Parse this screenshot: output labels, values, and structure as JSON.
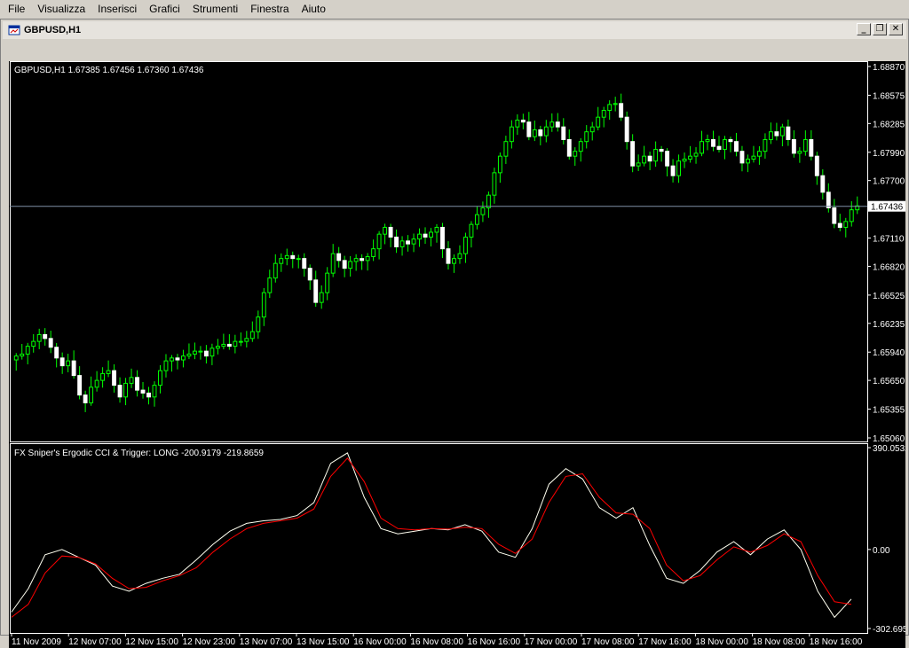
{
  "menu": {
    "items": [
      "File",
      "Visualizza",
      "Inserisci",
      "Grafici",
      "Strumenti",
      "Finestra",
      "Aiuto"
    ]
  },
  "window": {
    "title": "GBPUSD,H1",
    "buttons": {
      "minimize": "_",
      "restore": "❐",
      "close": "✕"
    }
  },
  "colors": {
    "background": "#000000",
    "bull": "#ffffff",
    "bear": "#ffffff",
    "wick": "#00ff00",
    "grid_frame": "#ffffff",
    "cci_line": "#fffff0",
    "trigger_line": "#ff0000",
    "price_line": "#7f8fa6"
  },
  "chart_data": [
    {
      "type": "candlestick",
      "symbol_info": "GBPUSD,H1  1.67385 1.67456 1.67360 1.67436",
      "current_price": 1.67436,
      "current_price_label": "1.67436",
      "ylim": [
        1.6506,
        1.6887
      ],
      "y_ticks": [
        "1.68870",
        "1.68575",
        "1.68285",
        "1.67990",
        "1.67700",
        "1.67110",
        "1.66820",
        "1.66525",
        "1.66235",
        "1.65940",
        "1.65650",
        "1.65355",
        "1.65060"
      ],
      "x_tick_labels": [
        "11 Nov 2009",
        "12 Nov 07:00",
        "12 Nov 15:00",
        "12 Nov 23:00",
        "13 Nov 07:00",
        "13 Nov 15:00",
        "16 Nov 00:00",
        "16 Nov 08:00",
        "16 Nov 16:00",
        "17 Nov 00:00",
        "17 Nov 08:00",
        "17 Nov 16:00",
        "18 Nov 00:00",
        "18 Nov 08:00",
        "18 Nov 16:00"
      ],
      "closes": [
        1.659,
        1.6592,
        1.66,
        1.6605,
        1.6612,
        1.6608,
        1.6599,
        1.6588,
        1.658,
        1.6585,
        1.657,
        1.655,
        1.6542,
        1.6558,
        1.6565,
        1.6572,
        1.6575,
        1.656,
        1.6548,
        1.6562,
        1.6568,
        1.6555,
        1.6552,
        1.6548,
        1.656,
        1.6575,
        1.6585,
        1.6588,
        1.6586,
        1.659,
        1.6592,
        1.6595,
        1.6595,
        1.659,
        1.6598,
        1.66,
        1.6602,
        1.66,
        1.6605,
        1.6605,
        1.6608,
        1.6615,
        1.663,
        1.6655,
        1.667,
        1.6685,
        1.669,
        1.6693,
        1.669,
        1.669,
        1.668,
        1.6668,
        1.6645,
        1.6655,
        1.6675,
        1.6695,
        1.6688,
        1.668,
        1.6687,
        1.669,
        1.6688,
        1.6692,
        1.67,
        1.6715,
        1.6722,
        1.6712,
        1.6702,
        1.6708,
        1.6705,
        1.671,
        1.6715,
        1.6712,
        1.6717,
        1.6722,
        1.67,
        1.6685,
        1.669,
        1.6695,
        1.6712,
        1.6725,
        1.6735,
        1.6742,
        1.6755,
        1.6778,
        1.6795,
        1.681,
        1.6825,
        1.6832,
        1.683,
        1.6815,
        1.6822,
        1.6816,
        1.6825,
        1.683,
        1.6825,
        1.6812,
        1.6795,
        1.68,
        1.681,
        1.682,
        1.6825,
        1.6835,
        1.6842,
        1.6848,
        1.6849,
        1.6835,
        1.681,
        1.6785,
        1.6788,
        1.6795,
        1.679,
        1.6802,
        1.68,
        1.6785,
        1.6775,
        1.679,
        1.6792,
        1.6795,
        1.6798,
        1.681,
        1.6812,
        1.6805,
        1.6802,
        1.6812,
        1.681,
        1.68,
        1.6788,
        1.6792,
        1.6795,
        1.68,
        1.6812,
        1.682,
        1.6816,
        1.6825,
        1.6812,
        1.6798,
        1.68,
        1.6812,
        1.6795,
        1.6775,
        1.6758,
        1.6742,
        1.6726,
        1.6722,
        1.6728,
        1.674,
        1.6744
      ]
    },
    {
      "type": "line",
      "indicator_label": "FX Sniper's Ergodic CCI & Trigger: LONG -200.9179 -219.8659",
      "ylim": [
        -302.695,
        390.0532
      ],
      "y_ticks": [
        "390.0532",
        "0.00",
        "-302.695"
      ],
      "series": [
        {
          "name": "Ergodic CCI",
          "values": [
            -240,
            -150,
            -20,
            0,
            -30,
            -60,
            -140,
            -160,
            -130,
            -110,
            -95,
            -40,
            20,
            70,
            100,
            110,
            115,
            130,
            180,
            330,
            370,
            200,
            80,
            60,
            70,
            80,
            75,
            95,
            70,
            -10,
            -30,
            80,
            250,
            310,
            270,
            160,
            120,
            160,
            15,
            -110,
            -130,
            -80,
            -10,
            30,
            -20,
            40,
            75,
            0,
            -160,
            -260,
            -190
          ]
        },
        {
          "name": "Trigger",
          "values": [
            -260,
            -210,
            -90,
            -25,
            -30,
            -55,
            -110,
            -150,
            -145,
            -120,
            -100,
            -70,
            -10,
            40,
            80,
            100,
            110,
            120,
            155,
            280,
            350,
            260,
            120,
            80,
            75,
            80,
            78,
            85,
            80,
            20,
            -15,
            40,
            180,
            280,
            290,
            200,
            140,
            135,
            80,
            -60,
            -120,
            -100,
            -40,
            10,
            -10,
            15,
            60,
            30,
            -100,
            -200,
            -210
          ]
        }
      ]
    }
  ]
}
